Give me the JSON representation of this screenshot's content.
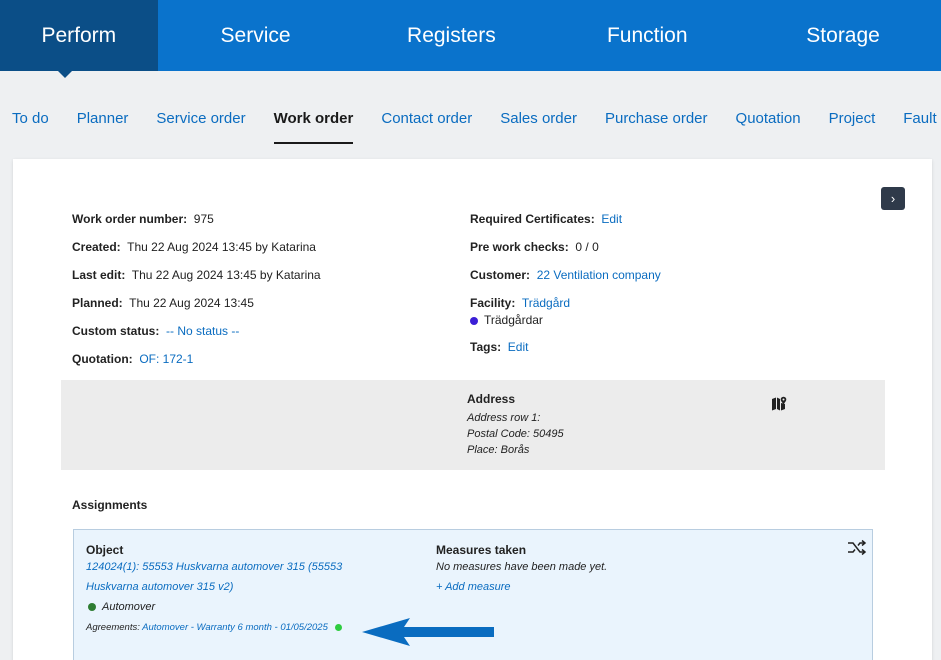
{
  "topnav": {
    "tabs": [
      {
        "label": "Perform",
        "active": true
      },
      {
        "label": "Service"
      },
      {
        "label": "Registers"
      },
      {
        "label": "Function"
      },
      {
        "label": "Storage"
      }
    ]
  },
  "subnav": {
    "items": [
      {
        "label": "To do"
      },
      {
        "label": "Planner"
      },
      {
        "label": "Service order"
      },
      {
        "label": "Work order",
        "active": true
      },
      {
        "label": "Contact order"
      },
      {
        "label": "Sales order"
      },
      {
        "label": "Purchase order"
      },
      {
        "label": "Quotation"
      },
      {
        "label": "Project"
      },
      {
        "label": "Fault"
      }
    ]
  },
  "details": {
    "work_order_number": {
      "label": "Work order number:",
      "value": "975"
    },
    "created": {
      "label": "Created:",
      "value": "Thu 22 Aug 2024 13:45 by Katarina"
    },
    "last_edit": {
      "label": "Last edit:",
      "value": "Thu 22 Aug 2024 13:45 by Katarina"
    },
    "planned": {
      "label": "Planned:",
      "value": "Thu 22 Aug 2024 13:45"
    },
    "custom_status": {
      "label": "Custom status:",
      "value": "-- No status --"
    },
    "quotation": {
      "label": "Quotation:",
      "value": "OF: 172-1"
    },
    "required_certificates": {
      "label": "Required Certificates:",
      "value": "Edit"
    },
    "pre_work_checks": {
      "label": "Pre work checks:",
      "value": "0 / 0"
    },
    "customer": {
      "label": "Customer:",
      "value": "22 Ventilation company"
    },
    "facility": {
      "label": "Facility:",
      "value": "Trädgård",
      "sub": "Trädgårdar",
      "dot_color": "#3b1fd6"
    },
    "tags": {
      "label": "Tags:",
      "value": "Edit"
    }
  },
  "address": {
    "title": "Address",
    "row1": "Address row 1:",
    "postal": "Postal Code: 50495",
    "place": "Place: Borås"
  },
  "assignments": {
    "title": "Assignments",
    "object_header": "Object",
    "object_link_line1": "124024(1): 55553 Huskvarna automover 315 (55553",
    "object_link_line2": "Huskvarna automover 315 v2)",
    "object_type": "Automover",
    "object_dot_color": "#2e7d32",
    "agreements_label": "Agreements:",
    "agreements_value": "Automover - Warranty 6 month - 01/05/2025",
    "agreement_dot_color": "#2ecc40",
    "measures_header": "Measures taken",
    "measures_empty": "No measures have been made yet.",
    "add_measure": "+ Add measure"
  },
  "colors": {
    "brand": "#0a73cc",
    "brand_dark": "#0b4e87",
    "link": "#0a6cc0",
    "arrow": "#0a6cc0"
  },
  "icons": {
    "expand": "chevron-right-icon",
    "map": "map-pin-icon",
    "shuffle": "shuffle-icon",
    "arrow": "arrow-left-icon"
  }
}
